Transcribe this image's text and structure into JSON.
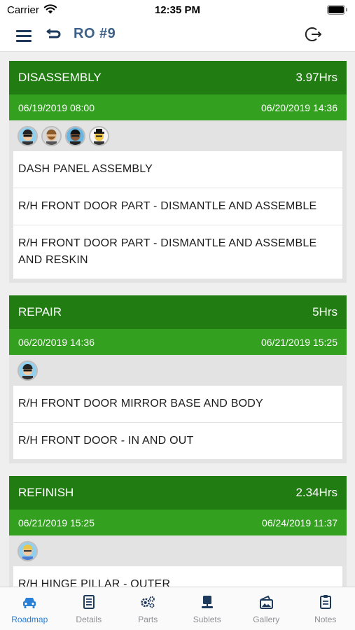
{
  "status_bar": {
    "carrier": "Carrier",
    "time": "12:35 PM"
  },
  "nav": {
    "title": "RO #9"
  },
  "sections": [
    {
      "name": "DISASSEMBLY",
      "hours": "3.97Hrs",
      "start": "06/19/2019 08:00",
      "end": "06/20/2019 14:36",
      "avatars": [
        "sunglasses-avatar",
        "bearded-avatar",
        "dark-skin-avatar",
        "hat-avatar"
      ],
      "tasks": [
        "DASH PANEL ASSEMBLY",
        "R/H FRONT DOOR PART - DISMANTLE AND ASSEMBLE",
        "R/H FRONT DOOR PART - DISMANTLE AND ASSEMBLE AND RESKIN"
      ]
    },
    {
      "name": "REPAIR",
      "hours": "5Hrs",
      "start": "06/20/2019 14:36",
      "end": "06/21/2019 15:25",
      "avatars": [
        "sunglasses-avatar"
      ],
      "tasks": [
        "R/H FRONT DOOR MIRROR BASE AND BODY",
        "R/H FRONT DOOR - IN AND OUT"
      ]
    },
    {
      "name": "REFINISH",
      "hours": "2.34Hrs",
      "start": "06/21/2019 15:25",
      "end": "06/24/2019 11:37",
      "avatars": [
        "blonde-avatar"
      ],
      "tasks": [
        "R/H HINGE PILLAR - OUTER",
        ""
      ]
    }
  ],
  "tabs": [
    {
      "label": "Roadmap",
      "icon": "car-icon",
      "active": true
    },
    {
      "label": "Details",
      "icon": "document-icon",
      "active": false
    },
    {
      "label": "Parts",
      "icon": "gears-icon",
      "active": false
    },
    {
      "label": "Sublets",
      "icon": "monitor-icon",
      "active": false
    },
    {
      "label": "Gallery",
      "icon": "gallery-icon",
      "active": false
    },
    {
      "label": "Notes",
      "icon": "notes-icon",
      "active": false
    }
  ],
  "colors": {
    "section_header": "#217d12",
    "section_dates": "#33a01f",
    "title": "#3d6188",
    "active_tab": "#2a7fd6",
    "inactive_tab": "#8e8e93"
  }
}
